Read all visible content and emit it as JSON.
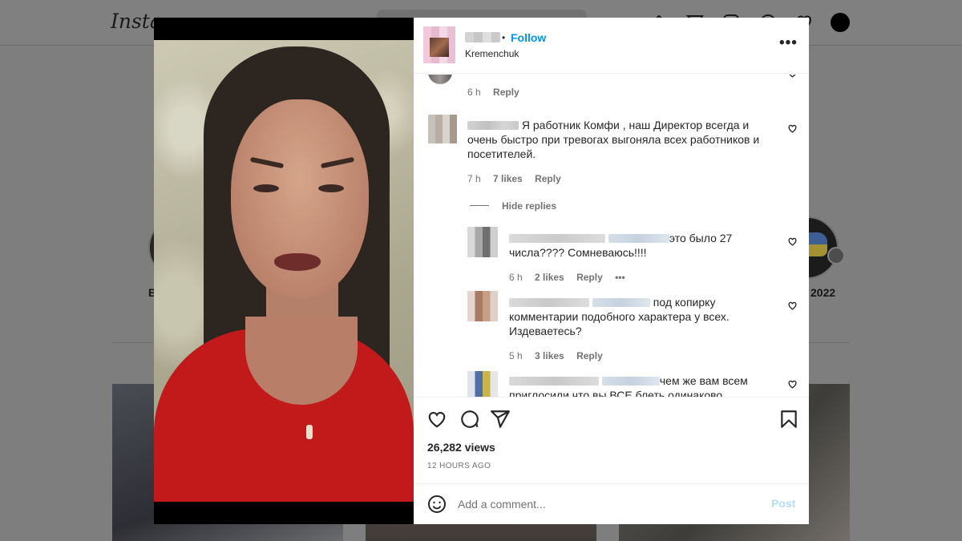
{
  "background": {
    "logo_text": "Insta",
    "highlights": [
      {
        "label": "B"
      },
      {
        "label": "2022"
      }
    ]
  },
  "post": {
    "location": "Kremenchuk",
    "follow_label": "Follow",
    "more_label": "•••",
    "views": "26,282 views",
    "posted_ago": "12 HOURS AGO"
  },
  "comments": [
    {
      "text": "",
      "time": "6 h",
      "reply_label": "Reply"
    },
    {
      "text": "Я работник Комфи , наш Директор всегда и очень быстро при тревогах выгоняла всех работников и посетителей.",
      "time": "7 h",
      "likes": "7 likes",
      "reply_label": "Reply"
    },
    {
      "hide_replies_label": "Hide replies"
    }
  ],
  "replies": [
    {
      "text": "это было 27 числа???? Сомневаюсь!!!!",
      "time": "6 h",
      "likes": "2 likes",
      "reply_label": "Reply",
      "more_label": "•••"
    },
    {
      "text": "под копирку комментарии подобного характера у всех. Издеваетесь?",
      "time": "5 h",
      "likes": "3 likes",
      "reply_label": "Reply"
    },
    {
      "text": "чем же вам всем приглосили что вы ВСЕ блеть одинаково"
    }
  ],
  "composer": {
    "placeholder": "Add a comment...",
    "post_label": "Post"
  },
  "colors": {
    "accent": "#0095f6",
    "post_disabled": "#b2dffc",
    "muted": "#737373"
  }
}
